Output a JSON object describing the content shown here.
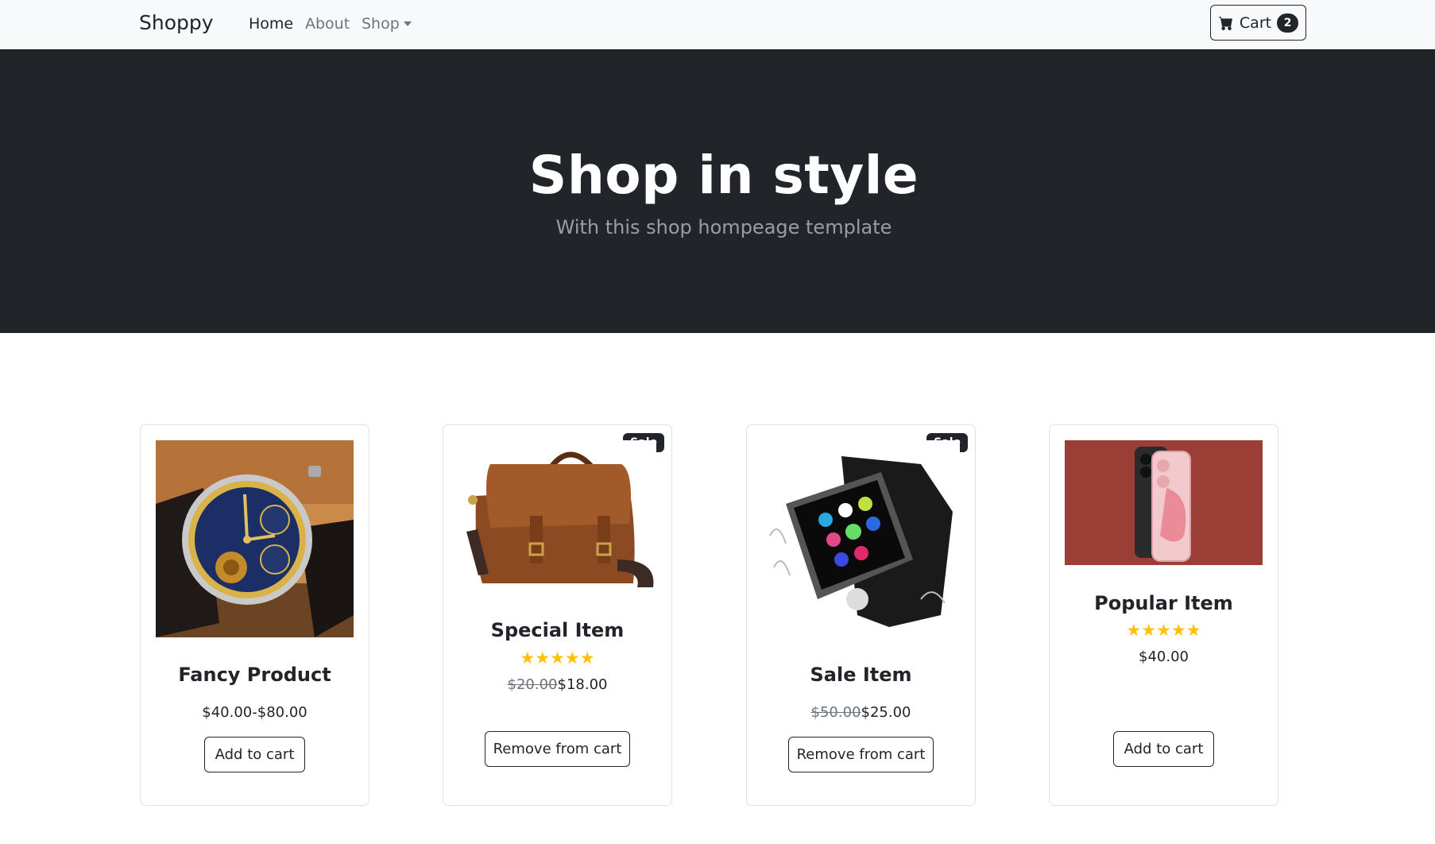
{
  "navbar": {
    "brand": "Shoppy",
    "links": [
      {
        "label": "Home",
        "active": true
      },
      {
        "label": "About",
        "active": false
      },
      {
        "label": "Shop",
        "active": false
      }
    ],
    "cart": {
      "label": "Cart",
      "count": "2",
      "icon": "cart-icon"
    }
  },
  "hero": {
    "title": "Shop in style",
    "subtitle": "With this shop hompeage template"
  },
  "products": [
    {
      "name": "Fancy Product",
      "badge": "",
      "rating": "",
      "old_price": "",
      "price": "$40.00-$80.00",
      "button": "Add to cart",
      "image": "wristwatch-photo"
    },
    {
      "name": "Special Item",
      "badge": "Sale",
      "rating": "★★★★★",
      "old_price": "$20.00",
      "price": "$18.00",
      "button": "Remove from cart",
      "image": "leather-messenger-bag-photo"
    },
    {
      "name": "Sale Item",
      "badge": "Sale",
      "rating": "",
      "old_price": "$50.00",
      "price": "$25.00",
      "button": "Remove from cart",
      "image": "smartwatch-photo"
    },
    {
      "name": "Popular Item",
      "badge": "",
      "rating": "★★★★★",
      "old_price": "",
      "price": "$40.00",
      "button": "Add to cart",
      "image": "smartphone-photo"
    }
  ],
  "colors": {
    "dark": "#212529",
    "navbar_bg": "#f8f9fa",
    "star": "#ffc107",
    "muted": "#6c757d"
  }
}
